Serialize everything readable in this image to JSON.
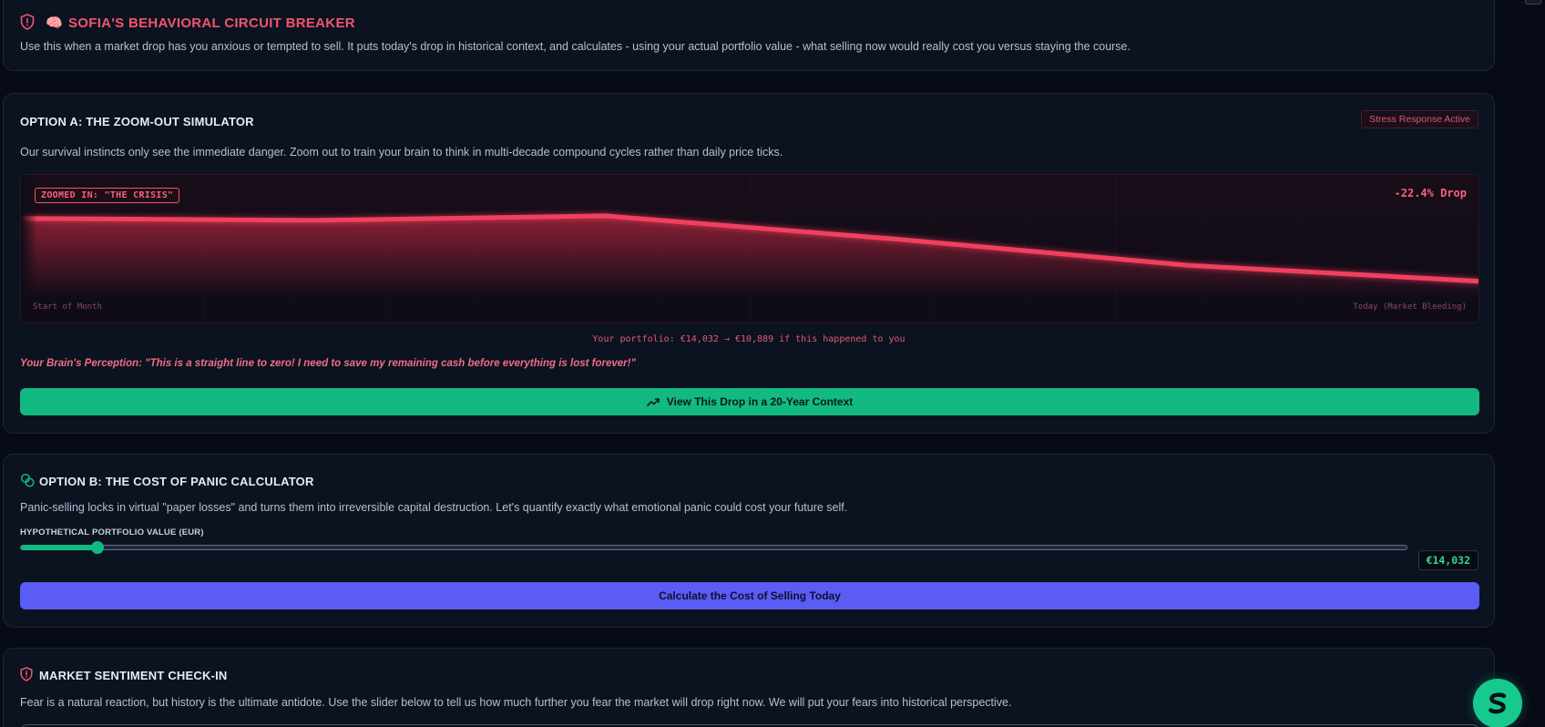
{
  "hero": {
    "brain_emoji": "🧠",
    "title": "SOFIA'S BEHAVIORAL CIRCUIT BREAKER",
    "description": "Use this when a market drop has you anxious or tempted to sell. It puts today's drop in historical context, and calculates - using your actual portfolio value - what selling now would really cost you versus staying the course."
  },
  "option_a": {
    "title": "OPTION A: THE ZOOM-OUT SIMULATOR",
    "badge": "Stress Response Active",
    "description": "Our survival instincts only see the immediate danger. Zoom out to train your brain to think in multi-decade compound cycles rather than daily price ticks.",
    "chart": {
      "zoom_tag": "ZOOMED IN: \"THE CRISIS\"",
      "drop_label": "-22.4% Drop",
      "start_label": "Start of Month",
      "end_label": "Today (Market Bleeding)"
    },
    "portfolio_note": "Your portfolio: €14,032 → €10,889 if this happened to you",
    "perception": "Your Brain's Perception: \"This is a straight line to zero! I need to save my remaining cash before everything is lost forever!\"",
    "button_label": "View This Drop in a 20-Year Context"
  },
  "option_b": {
    "title": "OPTION B: THE COST OF PANIC CALCULATOR",
    "description": "Panic-selling locks in virtual \"paper losses\" and turns them into irreversible capital destruction. Let's quantify exactly what emotional panic could cost your future self.",
    "slider_label": "HYPOTHETICAL PORTFOLIO VALUE (EUR)",
    "slider_fraction": 0.055,
    "value_display": "€14,032",
    "button_label": "Calculate the Cost of Selling Today"
  },
  "sentiment": {
    "title": "MARKET SENTIMENT CHECK-IN",
    "description": "Fear is a natural reaction, but history is the ultimate antidote. Use the slider below to tell us how much further you fear the market will drop right now. We will put your fears into historical perspective."
  },
  "chart_data": {
    "type": "area",
    "series": [
      {
        "values": [
          100,
          99.3,
          100.9,
          92.6,
          83.3,
          77.6
        ]
      }
    ],
    "title": "",
    "xlabel": "",
    "ylabel": ""
  },
  "colors": {
    "accent_red": "#f2556e",
    "accent_green": "#12b981",
    "accent_indigo": "#5b5cf5",
    "background": "#070b16"
  },
  "icons": {
    "hero": "shield-alert-icon",
    "trend": "trending-up-icon",
    "coins": "coins-icon",
    "sentiment": "shield-icon",
    "fab": "brand-s-logo-icon"
  }
}
